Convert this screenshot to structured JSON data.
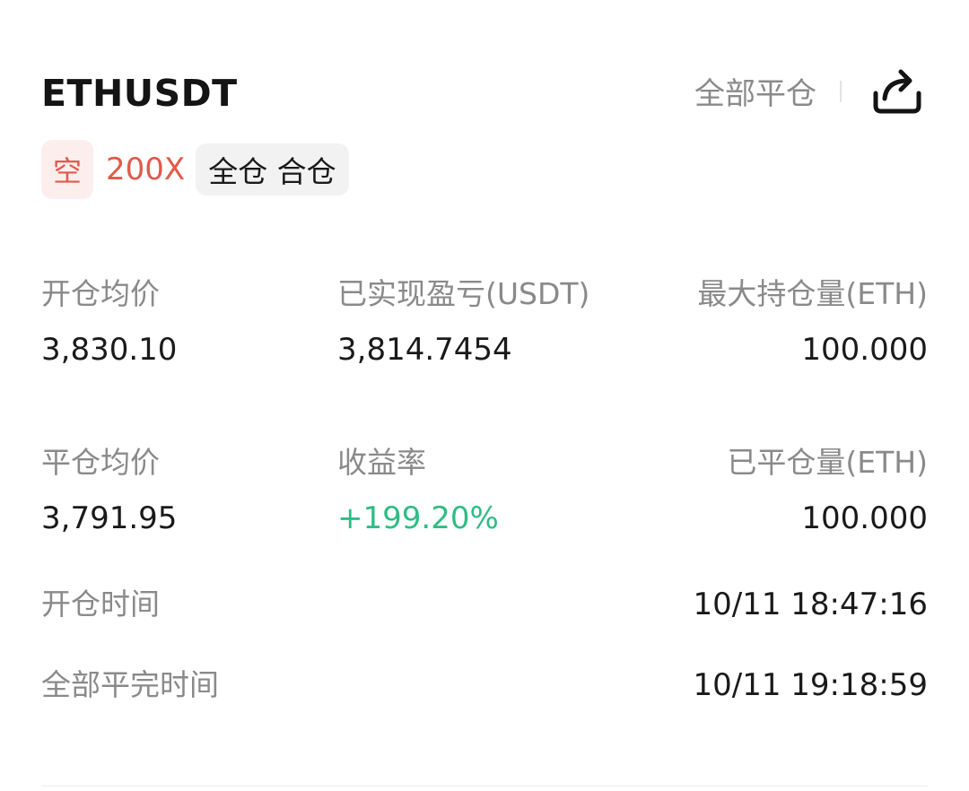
{
  "header": {
    "symbol": "ETHUSDT",
    "close_all_label": "全部平仓",
    "share_icon": "share-icon"
  },
  "tags": {
    "side": "空",
    "leverage": "200X",
    "mode": "全仓 合仓"
  },
  "colors": {
    "short_red": "#e05a4b",
    "profit_green": "#2ebd85",
    "label_gray": "#8a8a8a"
  },
  "stats": {
    "row1": {
      "avg_open_price_label": "开仓均价",
      "avg_open_price": "3,830.10",
      "realized_pnl_label": "已实现盈亏(USDT)",
      "realized_pnl": "3,814.7454",
      "max_position_label": "最大持仓量(ETH)",
      "max_position": "100.000"
    },
    "row2": {
      "avg_close_price_label": "平仓均价",
      "avg_close_price": "3,791.95",
      "roi_label": "收益率",
      "roi": "+199.20%",
      "closed_amount_label": "已平仓量(ETH)",
      "closed_amount": "100.000"
    },
    "open_time_label": "开仓时间",
    "open_time": "10/11 18:47:16",
    "close_time_label": "全部平完时间",
    "close_time": "10/11 19:18:59"
  }
}
